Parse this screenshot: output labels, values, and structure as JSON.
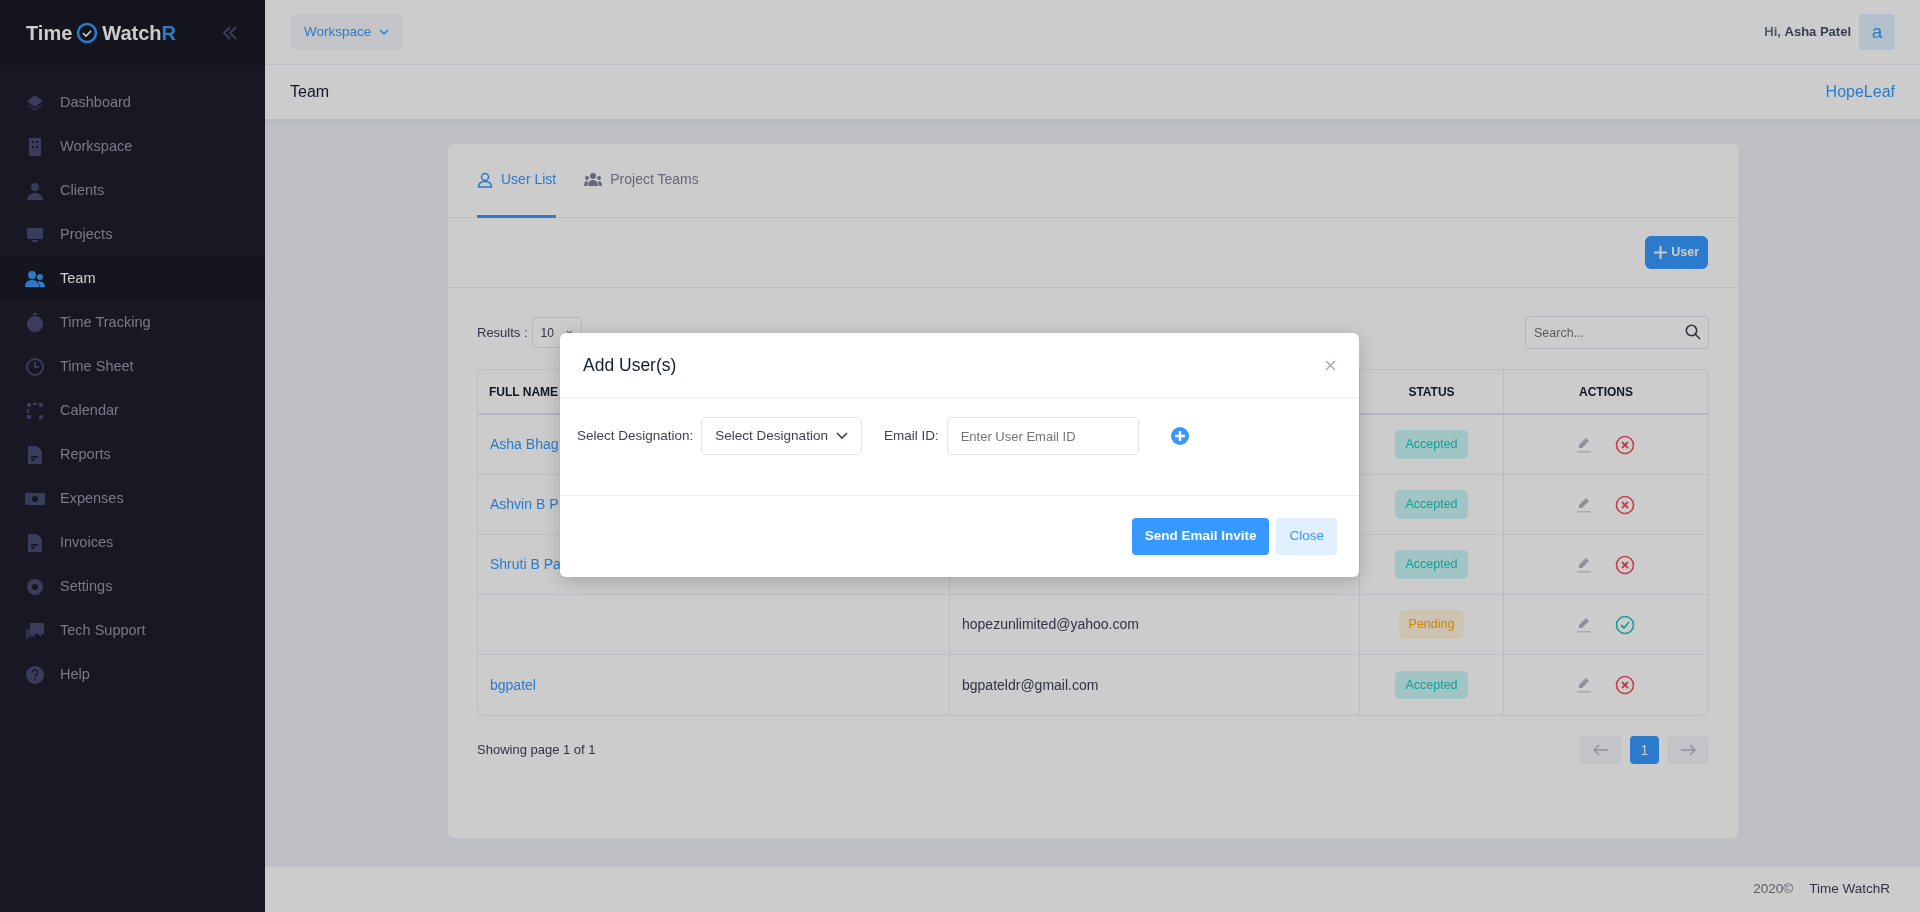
{
  "sidebar": {
    "logo": {
      "left": "Time",
      "right": "Watch",
      "accent": "R"
    },
    "items": [
      {
        "label": "Dashboard",
        "selected": false
      },
      {
        "label": "Workspace",
        "selected": false
      },
      {
        "label": "Clients",
        "selected": false
      },
      {
        "label": "Projects",
        "selected": false
      },
      {
        "label": "Team",
        "selected": true
      },
      {
        "label": "Time Tracking",
        "selected": false
      },
      {
        "label": "Time Sheet",
        "selected": false
      },
      {
        "label": "Calendar",
        "selected": false
      },
      {
        "label": "Reports",
        "selected": false
      },
      {
        "label": "Expenses",
        "selected": false
      },
      {
        "label": "Invoices",
        "selected": false
      },
      {
        "label": "Settings",
        "selected": false
      },
      {
        "label": "Tech Support",
        "selected": false
      },
      {
        "label": "Help",
        "selected": false
      }
    ]
  },
  "topbar": {
    "workspace_button": "Workspace",
    "greeting": "Hi,",
    "user_name": "Asha Patel",
    "avatar": "a"
  },
  "subheader": {
    "title": "Team",
    "org": "HopeLeaf"
  },
  "tabs": [
    {
      "label": "User List",
      "selected": true
    },
    {
      "label": "Project Teams",
      "selected": false
    }
  ],
  "add_user_button": "User",
  "results": {
    "label": "Results :",
    "value": "10"
  },
  "search": {
    "placeholder": "Search..."
  },
  "table": {
    "columns": {
      "name": "FULL NAME",
      "status": "STATUS",
      "actions": "ACTIONS"
    },
    "rows": [
      {
        "name": "Asha Bhag",
        "status": "Accepted",
        "kind": "accepted"
      },
      {
        "name": "Ashvin B P",
        "status": "Accepted",
        "kind": "accepted"
      },
      {
        "name": "Shruti B Pa",
        "status": "Accepted",
        "kind": "accepted"
      },
      {
        "email": "hopezunlimited@yahoo.com",
        "status": "Pending",
        "kind": "pending"
      },
      {
        "name": "bgpatel",
        "email": "bgpateldr@gmail.com",
        "status": "Accepted",
        "kind": "accepted"
      }
    ]
  },
  "pagination": {
    "summary": "Showing page 1 of 1",
    "pages": [
      {
        "label": "1",
        "selected": true
      }
    ]
  },
  "footer": {
    "year": "2020©",
    "brand": "Time WatchR"
  },
  "modal": {
    "title": "Add User(s)",
    "fields": [
      {
        "kind": "select",
        "label": "Select Designation:",
        "value": "Select Designation"
      },
      {
        "kind": "input",
        "label": "Email ID:",
        "placeholder": "Enter User Email ID"
      }
    ],
    "buttons": [
      {
        "kind": "primary",
        "label": "Send Email Invite"
      },
      {
        "kind": "light",
        "label": "Close"
      }
    ]
  }
}
